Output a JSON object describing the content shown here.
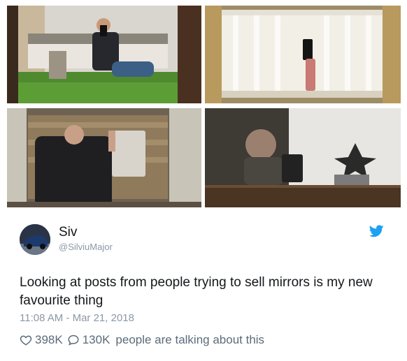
{
  "tweet": {
    "display_name": "Siv",
    "handle": "@SilviuMajor",
    "text": "Looking at posts from people trying to sell mirrors is my new favourite thing",
    "timestamp": "11:08 AM - Mar 21, 2018",
    "likes": "398K",
    "replies": "130K",
    "talking_label": "people are talking about this"
  },
  "icons": {
    "brand": "twitter-bird-icon",
    "like": "heart-icon",
    "reply": "speech-bubble-icon"
  },
  "colors": {
    "brand_blue": "#1da1f2",
    "secondary_text": "#8b98a5",
    "primary_text": "#14171a"
  },
  "photos": [
    {
      "name": "mirror-photo-living-room"
    },
    {
      "name": "mirror-photo-staircase"
    },
    {
      "name": "mirror-photo-man-tablet"
    },
    {
      "name": "mirror-photo-woman-phone"
    }
  ]
}
